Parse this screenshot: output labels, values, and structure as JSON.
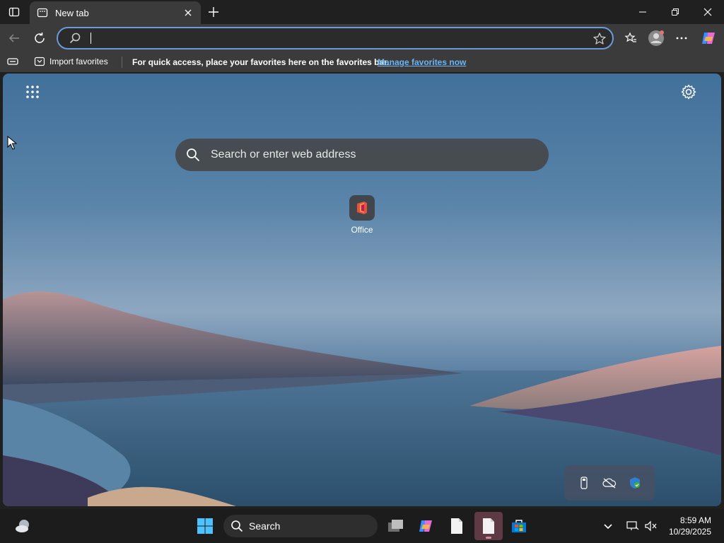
{
  "browser": {
    "tab": {
      "title": "New tab"
    },
    "address": {
      "value": "",
      "placeholder": ""
    },
    "favorites_bar": {
      "import_label": "Import favorites",
      "message": "For quick access, place your favorites here on the favorites bar.",
      "manage_link": "Manage favorites now"
    }
  },
  "ntp": {
    "search_placeholder": "Search or enter web address",
    "tiles": [
      {
        "label": "Office"
      }
    ]
  },
  "taskbar": {
    "search_label": "Search",
    "clock": {
      "time": "8:59 AM",
      "date": "10/29/2025"
    }
  },
  "colors": {
    "accent": "#6b9bd8",
    "link": "#6cb4f5",
    "window_bg": "#202020",
    "toolbar_bg": "#3b3b3b"
  }
}
